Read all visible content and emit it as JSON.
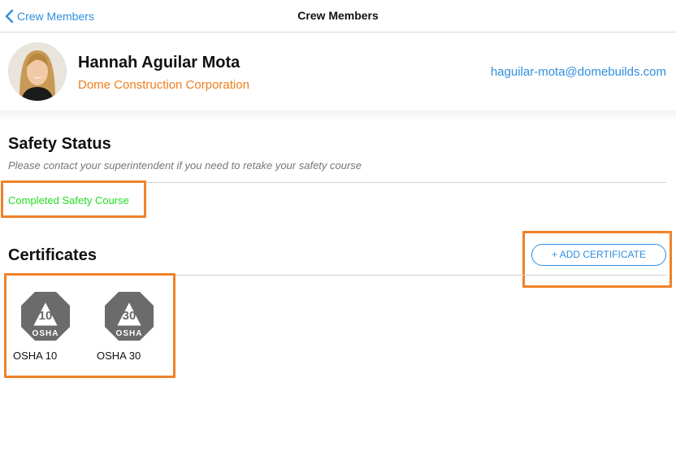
{
  "navbar": {
    "back_label": "Crew Members",
    "title": "Crew Members"
  },
  "profile": {
    "name": "Hannah Aguilar Mota",
    "company": "Dome Construction Corporation",
    "email": "haguilar-mota@domebuilds.com"
  },
  "safety": {
    "title": "Safety Status",
    "note": "Please contact your superintendent if you need to retake your safety course",
    "status": "Completed Safety Course"
  },
  "certificates": {
    "title": "Certificates",
    "add_label": "+ ADD CERTIFICATE",
    "items": [
      {
        "number": "10",
        "badge_text": "OSHA",
        "label": "OSHA 10",
        "icon": "osha-10-badge-icon"
      },
      {
        "number": "30",
        "badge_text": "OSHA",
        "label": "OSHA 30",
        "icon": "osha-30-badge-icon"
      }
    ]
  },
  "colors": {
    "link_blue": "#2f8ee0",
    "company_orange": "#f07d1a",
    "status_green": "#22dd22",
    "highlight_orange": "#f08228",
    "badge_gray": "#6b6b6b"
  }
}
